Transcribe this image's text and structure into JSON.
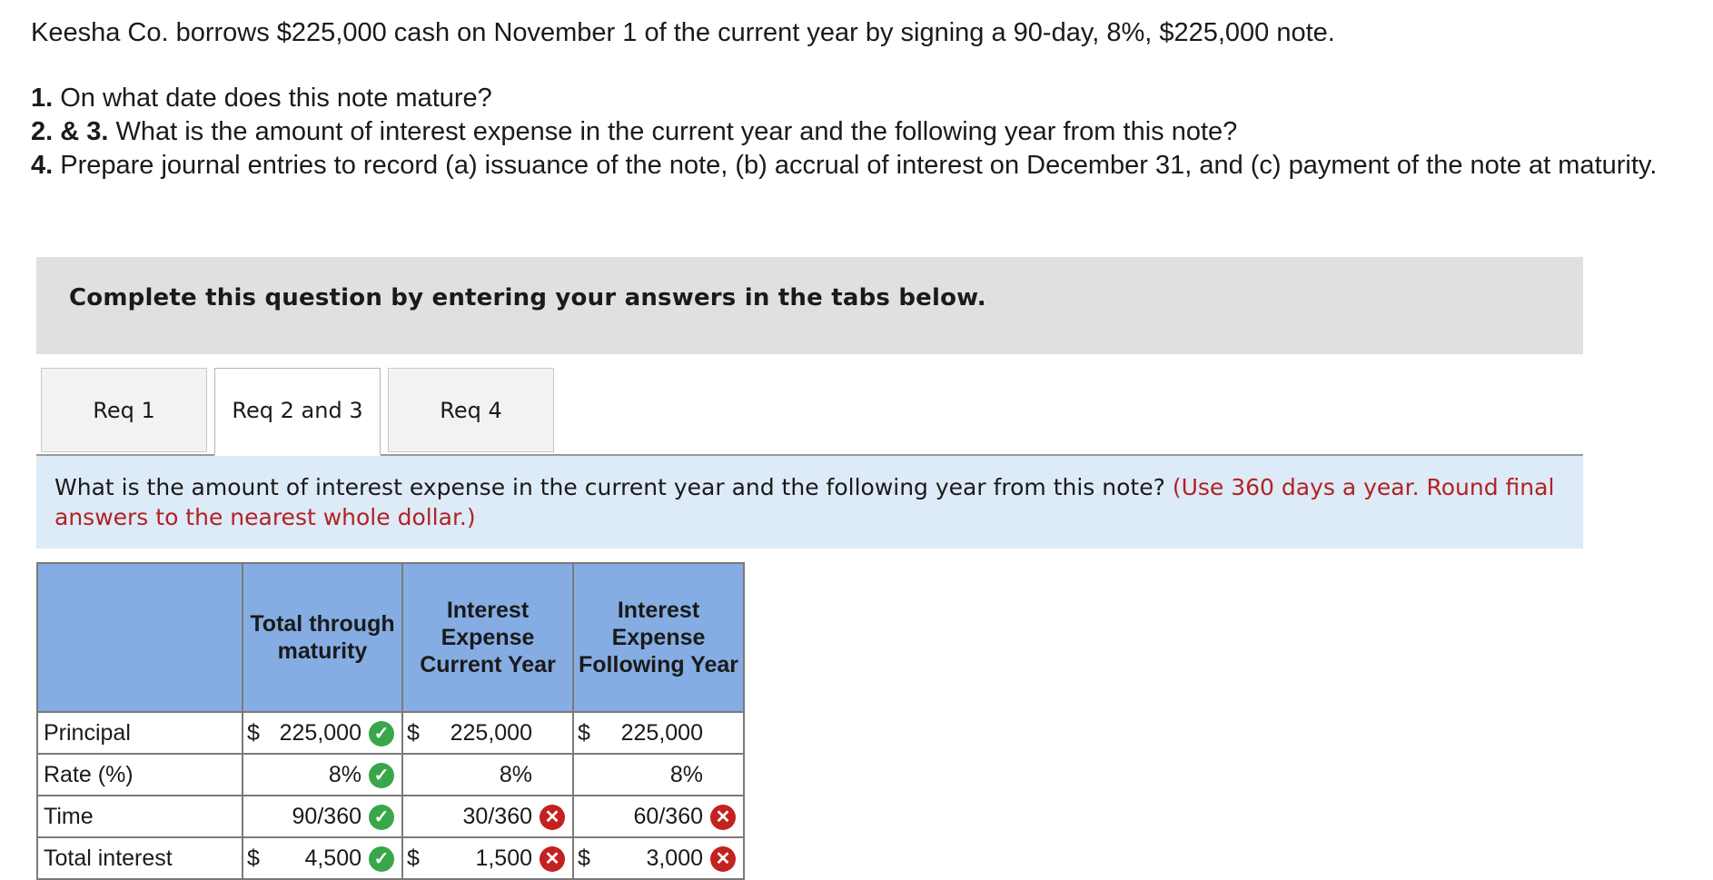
{
  "problem": {
    "intro": "Keesha Co. borrows $225,000 cash on November 1 of the current year by signing a 90-day, 8%, $225,000 note.",
    "q1_num": "1.",
    "q1_text": " On what date does this note mature?",
    "q23_num": "2. & 3.",
    "q23_text": " What is the amount of interest expense in the current year and the following year from this note?",
    "q4_num": "4.",
    "q4_text": " Prepare journal entries to record (a) issuance of the note, (b) accrual of interest on December 31, and (c) payment of the note at maturity."
  },
  "banner": "Complete this question by entering your answers in the tabs below.",
  "tabs": [
    {
      "label": "Req 1",
      "active": false
    },
    {
      "label": "Req 2 and 3",
      "active": true
    },
    {
      "label": "Req 4",
      "active": false
    }
  ],
  "instruction": {
    "text": "What is the amount of interest expense in the current year and the following year from this note? ",
    "note": "(Use 360 days a year. Round final answers to the nearest whole dollar.)"
  },
  "table": {
    "headers": [
      "",
      "Total through maturity",
      "Interest Expense Current Year",
      "Interest Expense Following Year"
    ],
    "rows": {
      "principal": {
        "label": "Principal",
        "total": "225,000",
        "current": "225,000",
        "following": "225,000",
        "dollar": "$"
      },
      "rate": {
        "label": "Rate (%)",
        "total": "8%",
        "current": "8%",
        "following": "8%"
      },
      "time": {
        "label": "Time",
        "total": "90/360",
        "current": "30/360",
        "following": "60/360"
      },
      "interest": {
        "label": "Total interest",
        "total": "4,500",
        "current": "1,500",
        "following": "3,000",
        "dollar": "$"
      }
    },
    "marks": {
      "correct_icon": "check-circle-icon",
      "wrong_icon": "x-circle-icon",
      "correct_color": "#3aa64a",
      "wrong_color": "#c42121"
    }
  }
}
